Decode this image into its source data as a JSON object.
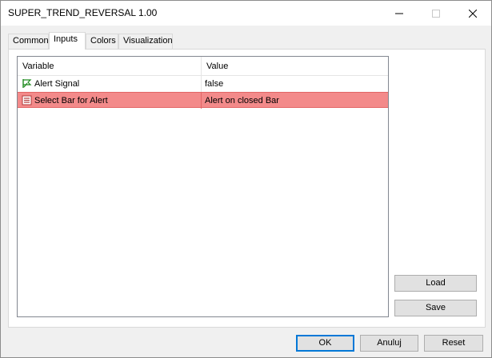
{
  "window": {
    "title": "SUPER_TREND_REVERSAL 1.00"
  },
  "tabs": [
    {
      "label": "Common"
    },
    {
      "label": "Inputs",
      "active": true
    },
    {
      "label": "Colors"
    },
    {
      "label": "Visualization"
    }
  ],
  "table": {
    "columns": [
      "Variable",
      "Value"
    ],
    "rows": [
      {
        "variable": "Alert Signal",
        "value": "false",
        "icon": "boolean-flag-icon"
      },
      {
        "variable": "Select Bar for Alert",
        "value": "Alert on closed Bar",
        "icon": "enum-list-icon",
        "selected": true
      }
    ],
    "selected_row_color": "#f38a8a"
  },
  "buttons": {
    "load": "Load",
    "save": "Save",
    "ok": "OK",
    "cancel": "Anuluj",
    "reset": "Reset"
  },
  "icons": {
    "minimize": "minimize-icon",
    "maximize": "maximize-icon",
    "close": "close-icon"
  }
}
